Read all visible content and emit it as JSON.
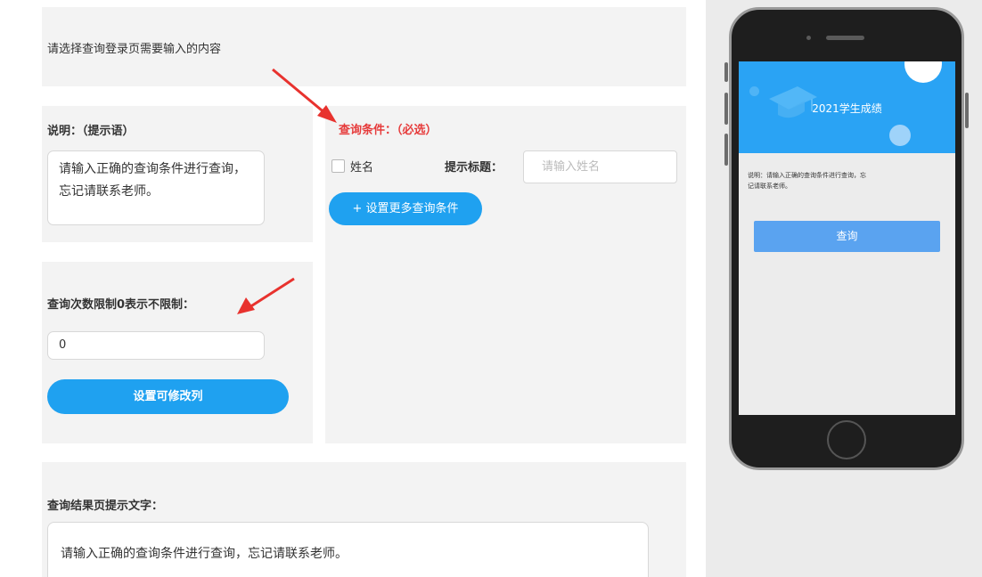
{
  "header": {
    "prompt": "请选择查询登录页需要输入的内容"
  },
  "description": {
    "title": "说明：（提示语）",
    "text": "请输入正确的查询条件进行查询，忘记请联系老师。"
  },
  "limit": {
    "title": "查询次数限制0表示不限制：",
    "value": "0",
    "set_columns_label": "设置可修改列"
  },
  "conditions": {
    "title": "查询条件：（必选）",
    "name_checkbox_label": "姓名",
    "hint_label": "提示标题：",
    "name_placeholder": "请输入姓名",
    "more_button": "+ 设置更多查询条件"
  },
  "result": {
    "title": "查询结果页提示文字：",
    "text": "请输入正确的查询条件进行查询，忘记请联系老师。"
  },
  "preview": {
    "banner_title": "2021学生成绩",
    "desc_line1": "说明：请输入正确的查询条件进行查询，忘",
    "desc_line2": "记请联系老师。",
    "query_button": "查询"
  },
  "colors": {
    "accent": "#1fa1f0",
    "required_red": "#e63b3b",
    "panel_bg": "#f3f3f3"
  }
}
